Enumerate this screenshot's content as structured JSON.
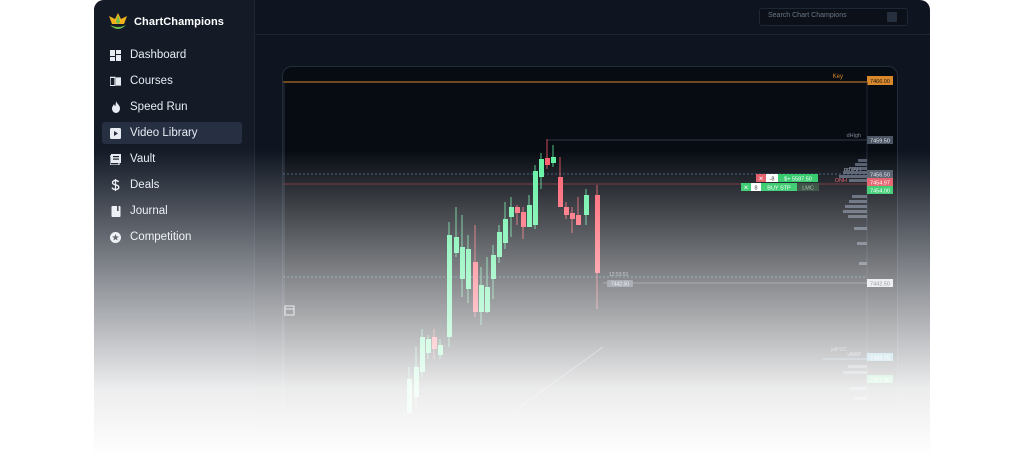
{
  "brand": {
    "name": "ChartChampions"
  },
  "search": {
    "placeholder": "Search Chart Champions"
  },
  "sidebar": {
    "items": [
      {
        "label": "Dashboard",
        "icon": "dashboard-icon"
      },
      {
        "label": "Courses",
        "icon": "book-icon"
      },
      {
        "label": "Speed Run",
        "icon": "flame-icon"
      },
      {
        "label": "Video Library",
        "icon": "video-icon",
        "active": true
      },
      {
        "label": "Vault",
        "icon": "vault-icon"
      },
      {
        "label": "Deals",
        "icon": "dollar-icon"
      },
      {
        "label": "Journal",
        "icon": "journal-icon"
      },
      {
        "label": "Competition",
        "icon": "star-icon"
      }
    ]
  },
  "chart": {
    "level_labels": {
      "key": "Key",
      "dhigh": "dHigh",
      "pdvah": "pdVAH",
      "onh": "ONH",
      "vwap": "vWAP",
      "poc": "pdPOC"
    },
    "price_tags": {
      "key": "7466.00",
      "dhigh": "7459.50",
      "pdvah": "7456.50",
      "onh": "7454.97",
      "green": "7454.00",
      "last": "7442.50",
      "vwap": "7433.75",
      "bottom": "7431.00"
    },
    "order": {
      "qty_sell": "-8",
      "pnl": "$+ 5587.50",
      "qty_buy": "8",
      "buy_label": "BUY STP",
      "close_label": "LMC"
    },
    "timer": "12:53:51",
    "last_badge": "7442.50"
  },
  "colors": {
    "app_bg": "#0f1520",
    "sidebar_bg": "#141b27",
    "bull": "#5ef0a0",
    "bear": "#ff5a6a",
    "key_line": "#d9892b",
    "accent_green": "#22c55e"
  }
}
